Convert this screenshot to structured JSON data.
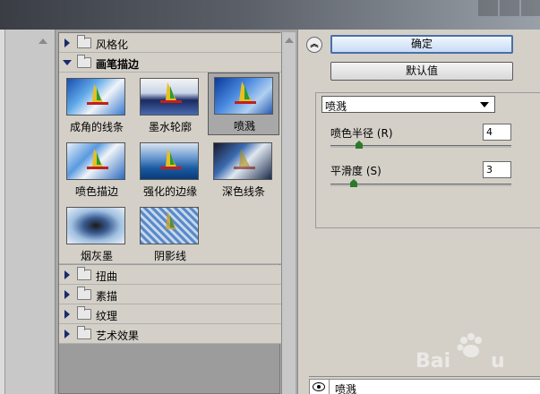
{
  "gallery": {
    "categories_top": [
      {
        "label": "风格化",
        "expanded": false
      }
    ],
    "open_category": {
      "label": "画笔描边",
      "expanded": true
    },
    "thumbnails": [
      {
        "label": "成角的线条",
        "selected": false
      },
      {
        "label": "墨水轮廓",
        "selected": false
      },
      {
        "label": "喷溅",
        "selected": true
      },
      {
        "label": "喷色描边",
        "selected": false
      },
      {
        "label": "强化的边缘",
        "selected": false
      },
      {
        "label": "深色线条",
        "selected": false
      },
      {
        "label": "烟灰墨",
        "selected": false
      },
      {
        "label": "阴影线",
        "selected": false
      }
    ],
    "categories_bottom": [
      {
        "label": "扭曲",
        "expanded": false
      },
      {
        "label": "素描",
        "expanded": false
      },
      {
        "label": "纹理",
        "expanded": false
      },
      {
        "label": "艺术效果",
        "expanded": false
      }
    ]
  },
  "panel": {
    "ok_label": "确定",
    "default_label": "默认值",
    "filter_select": "喷溅",
    "params": [
      {
        "label": "喷色半径 (R)",
        "value": "4",
        "fraction": 0.16
      },
      {
        "label": "平滑度 (S)",
        "value": "3",
        "fraction": 0.13
      }
    ]
  },
  "layers": {
    "items": [
      {
        "label": "喷溅"
      }
    ]
  },
  "colors": {
    "accent": "#4a6fa8",
    "panel_bg": "#d4d0c8",
    "slider_thumb": "#2a7a2a"
  }
}
